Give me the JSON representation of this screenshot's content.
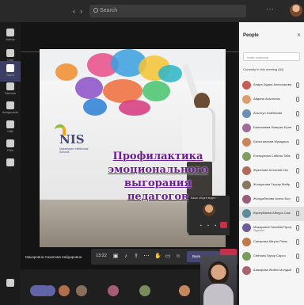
{
  "header": {
    "back_glyph": "‹",
    "forward_glyph": "›",
    "search_placeholder": "Search",
    "more_glyph": "···"
  },
  "rail": {
    "items": [
      {
        "label": "Activity",
        "icon": "bell-icon"
      },
      {
        "label": "Chat",
        "icon": "chat-icon"
      },
      {
        "label": "Teams",
        "icon": "teams-icon"
      },
      {
        "label": "Calendar",
        "icon": "calendar-icon"
      },
      {
        "label": "Assignments",
        "icon": "assignments-icon"
      },
      {
        "label": "Calls",
        "icon": "phone-icon"
      },
      {
        "label": "Files",
        "icon": "files-icon"
      },
      {
        "label": "...",
        "icon": "more-icon"
      }
    ]
  },
  "slide": {
    "logo_text": "NIS",
    "logo_sub": "Nazarbayev Intellectual Schools",
    "title_lines": [
      "Профилактика",
      "эмоционального выгорания",
      "педагогов"
    ]
  },
  "self_preview": {
    "caption": "Ваше общее видео  ···"
  },
  "controls": {
    "timer": "13:22",
    "leave_label": "Вывести экран",
    "items": [
      "camera-icon",
      "mic-icon",
      "share-icon",
      "more-icon",
      "raise-hand-icon",
      "chat-icon",
      "participants-icon"
    ]
  },
  "presenter_caption": "Макаровна Сахипова Кайдаровна",
  "people": {
    "title": "People",
    "search_placeholder": "Invite someone",
    "section_label": "Currently in this meeting (54)",
    "participants": [
      {
        "name": "Анара Худжа Аспосимова",
        "role": "",
        "color": "#c85a54"
      },
      {
        "name": "Айдана Асылгалы",
        "role": "",
        "color": "#d9a06d"
      },
      {
        "name": "Асылгул Атабекова",
        "role": "",
        "color": "#6b8fb5"
      },
      {
        "name": "Балгазиева Назерке Ерлан",
        "role": "",
        "color": "#a06b9a"
      },
      {
        "name": "Бахытжанова Мукадаса",
        "role": "",
        "color": "#c9865a"
      },
      {
        "name": "Есенкулова Сабина Тайк",
        "role": "",
        "color": "#7f9d62"
      },
      {
        "name": "Жукенова Алтынай Сек",
        "role": "",
        "color": "#b06b5a"
      },
      {
        "name": "Жолдасова Гаухар Майр",
        "role": "",
        "color": "#8a7560"
      },
      {
        "name": "Жолдыбекова Асель Бол",
        "role": "",
        "color": "#9c5d7a"
      },
      {
        "name": "Кушербаева Айнура Саж",
        "role": "",
        "color": "#5d8b9c"
      },
      {
        "name": "Макаровна Галиёва Профил",
        "role": "Organizer",
        "color": "#6d5a9a"
      },
      {
        "name": "Сапарова Айгуль Рахм",
        "role": "",
        "color": "#c07a4a"
      },
      {
        "name": "Сейтова Гауыр Сарсо",
        "role": "",
        "color": "#7a9b5e"
      },
      {
        "name": "Шакирова Жибек Молдыбаев",
        "role": "",
        "color": "#a8646e"
      }
    ]
  }
}
